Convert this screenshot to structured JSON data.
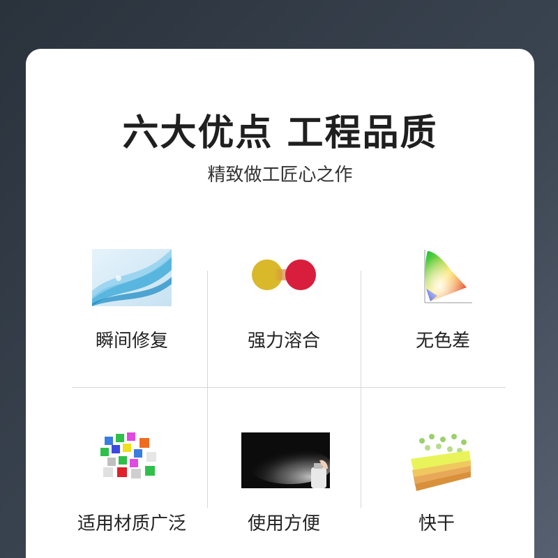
{
  "header": {
    "title": "六大优点  工程品质",
    "subtitle": "精致做工匠心之作"
  },
  "features": [
    {
      "label": "瞬间修复",
      "icon": "wave-image-icon"
    },
    {
      "label": "强力溶合",
      "icon": "merge-circles-icon"
    },
    {
      "label": "无色差",
      "icon": "color-gamut-icon"
    },
    {
      "label": "适用材质广泛",
      "icon": "color-cubes-icon"
    },
    {
      "label": "使用方便",
      "icon": "spray-can-icon"
    },
    {
      "label": "快干",
      "icon": "drying-layers-icon"
    }
  ],
  "colors": {
    "background": "#2f3944",
    "card": "#ffffff",
    "divider": "#d6d6d6",
    "yellow_circle": "#d9b82a",
    "red_circle": "#d81e3c"
  }
}
